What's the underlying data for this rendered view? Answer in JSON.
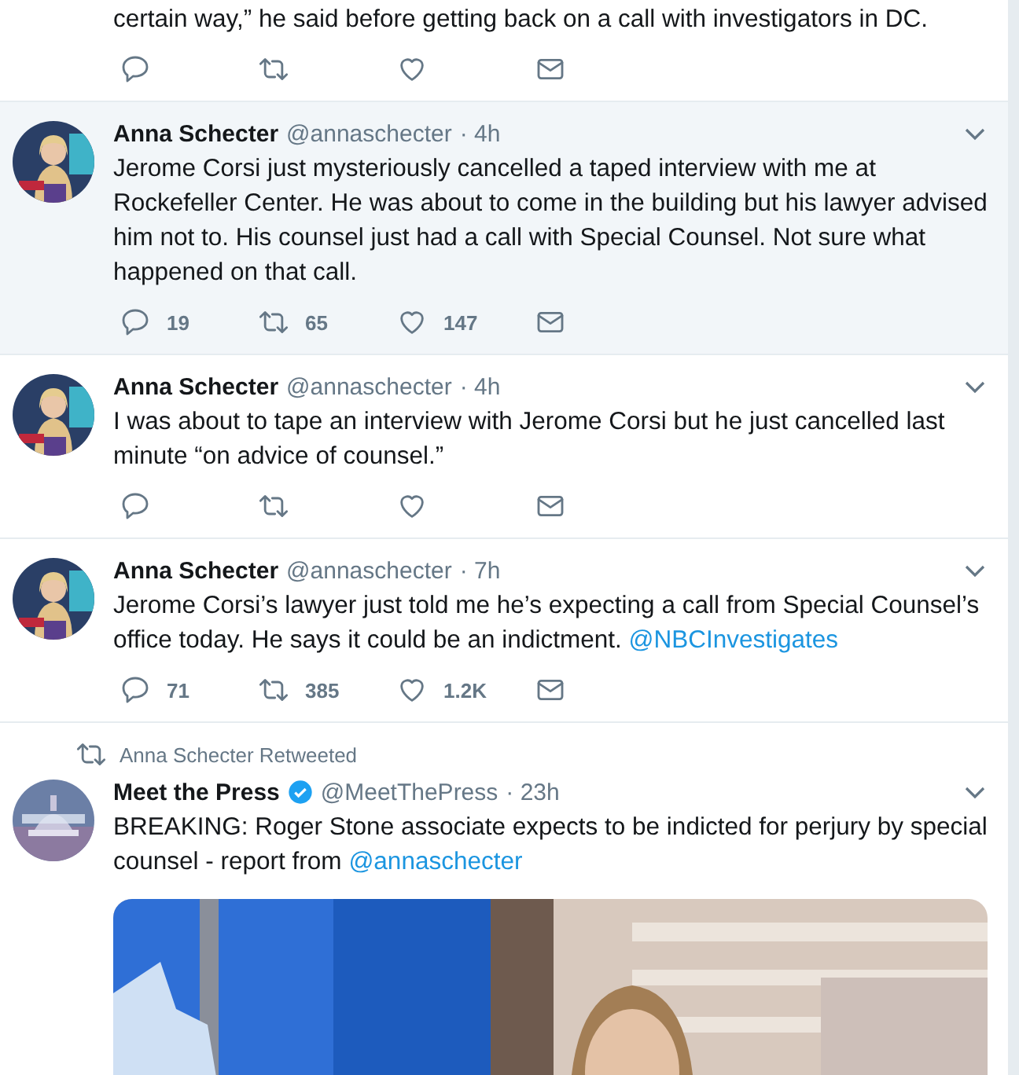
{
  "tweets": [
    {
      "partial": true,
      "highlighted": false,
      "text": [
        {
          "kind": "plain",
          "text": "certain way,” he said before getting back on a call with investigators in DC."
        }
      ],
      "actions": [
        {
          "kind": "reply"
        },
        {
          "kind": "retweet"
        },
        {
          "kind": "like"
        },
        {
          "kind": "message"
        }
      ]
    },
    {
      "partial": false,
      "highlighted": true,
      "name": "Anna Schecter",
      "verified": false,
      "handle": "@annaschecter",
      "time": "· 4h",
      "avatar": {
        "kind": "picture"
      },
      "text": [
        {
          "kind": "plain",
          "text": "Jerome Corsi just mysteriously cancelled a taped interview with me at Rockefeller Center. He was about to come in the building but his lawyer advised him not to. His counsel just had a call with Special Counsel. Not sure what happened on that call."
        }
      ],
      "actions": [
        {
          "kind": "reply",
          "count": "19"
        },
        {
          "kind": "retweet",
          "count": "65"
        },
        {
          "kind": "like",
          "count": "147"
        },
        {
          "kind": "message"
        }
      ]
    },
    {
      "partial": false,
      "highlighted": false,
      "name": "Anna Schecter",
      "verified": false,
      "handle": "@annaschecter",
      "time": "· 4h",
      "avatar": {
        "kind": "picture"
      },
      "text": [
        {
          "kind": "plain",
          "text": "I was about to tape an interview with Jerome Corsi but he just cancelled last minute “on advice of counsel.”"
        }
      ],
      "actions": [
        {
          "kind": "reply"
        },
        {
          "kind": "retweet"
        },
        {
          "kind": "like"
        },
        {
          "kind": "message"
        }
      ]
    },
    {
      "partial": false,
      "highlighted": false,
      "name": "Anna Schecter",
      "verified": false,
      "handle": "@annaschecter",
      "time": "· 7h",
      "avatar": {
        "kind": "picture"
      },
      "text": [
        {
          "kind": "plain",
          "text": "Jerome Corsi’s lawyer just told me he’s expecting a call from Special Counsel’s office today. He says it could be an indictment. "
        },
        {
          "kind": "link",
          "text": "@NBCInvestigates"
        }
      ],
      "actions": [
        {
          "kind": "reply",
          "count": "71"
        },
        {
          "kind": "retweet",
          "count": "385"
        },
        {
          "kind": "like",
          "count": "1.2K"
        },
        {
          "kind": "message"
        }
      ]
    },
    {
      "partial": false,
      "highlighted": false,
      "retweeted_by": "Anna Schecter Retweeted",
      "name": "Meet the Press",
      "verified": true,
      "handle": "@MeetThePress",
      "time": "· 23h",
      "avatar": {
        "kind": "picture"
      },
      "text": [
        {
          "kind": "plain",
          "text": "BREAKING: Roger Stone associate expects to be indicted for perjury by special counsel - report from "
        },
        {
          "kind": "link",
          "text": "@annaschecter"
        }
      ],
      "media": {
        "kind": "picture"
      }
    }
  ]
}
